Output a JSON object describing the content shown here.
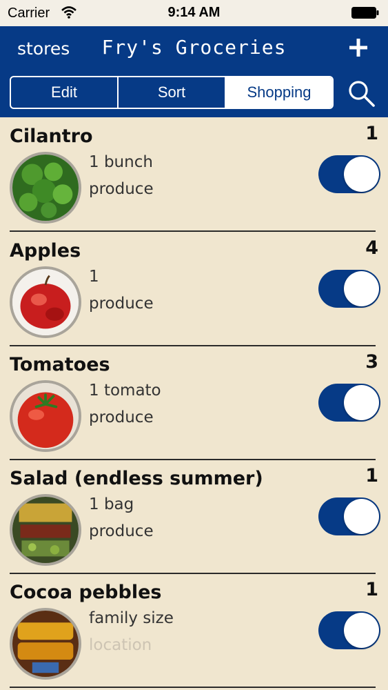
{
  "status_bar": {
    "carrier": "Carrier",
    "time": "9:14 AM"
  },
  "nav": {
    "back_label": "stores",
    "title": "Fry's Groceries",
    "segments": [
      "Edit",
      "Sort",
      "Shopping"
    ],
    "active_segment": "Shopping"
  },
  "items": [
    {
      "name": "Cilantro",
      "qty": "1",
      "amount": "1 bunch",
      "location": "produce",
      "in_cart": true
    },
    {
      "name": "Apples",
      "qty": "4",
      "amount": "1",
      "location": "produce",
      "in_cart": true
    },
    {
      "name": "Tomatoes",
      "qty": "3",
      "amount": "1 tomato",
      "location": "produce",
      "in_cart": true
    },
    {
      "name": "Salad (endless summer)",
      "qty": "1",
      "amount": "1 bag",
      "location": "produce",
      "in_cart": true
    },
    {
      "name": "Cocoa pebbles",
      "qty": "1",
      "amount": "family size",
      "location": "location",
      "in_cart": true
    }
  ],
  "colors": {
    "nav_blue": "#063a86",
    "paper": "#f0e6cf"
  }
}
